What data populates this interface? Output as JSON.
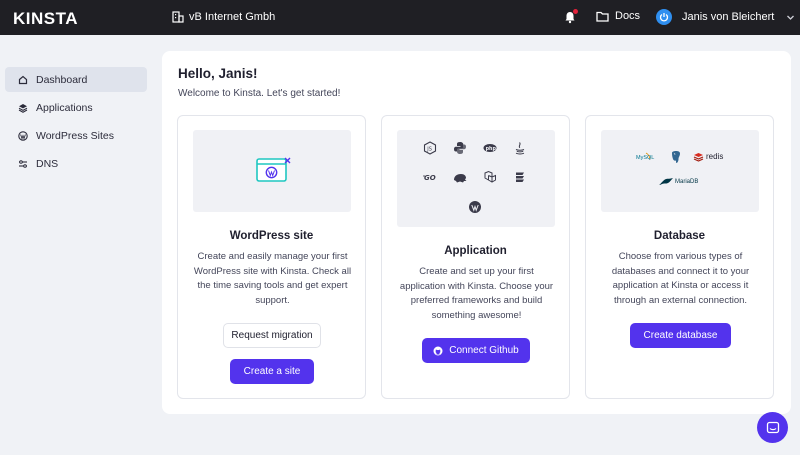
{
  "topbar": {
    "logo": "KINSTA",
    "company": "vB Internet Gmbh",
    "docs_label": "Docs",
    "user_name": "Janis von Bleichert"
  },
  "sidebar": {
    "items": [
      {
        "label": "Dashboard",
        "icon": "home-icon",
        "active": true
      },
      {
        "label": "Applications",
        "icon": "layers-icon",
        "active": false
      },
      {
        "label": "WordPress Sites",
        "icon": "wordpress-icon",
        "active": false
      },
      {
        "label": "DNS",
        "icon": "dns-icon",
        "active": false
      }
    ]
  },
  "main": {
    "greeting": "Hello, Janis!",
    "welcome": "Welcome to Kinsta. Let's get started!",
    "cards": [
      {
        "title": "WordPress site",
        "description_lines": [
          "Create and easily manage your first",
          "WordPress site with Kinsta. Check all",
          "the time saving tools and get expert",
          "support."
        ],
        "secondary_button": "Request migration",
        "primary_button": "Create a site"
      },
      {
        "title": "Application",
        "description_lines": [
          "Create and set up your first",
          "application with Kinsta. Choose your",
          "preferred frameworks and build",
          "something awesome!"
        ],
        "primary_button": "Connect Github"
      },
      {
        "title": "Database",
        "description_lines": [
          "Choose from various types of",
          "databases and connect it to your",
          "application at Kinsta or access it",
          "through an external connection."
        ],
        "primary_button": "Create database",
        "logos": [
          "MySQL",
          "redis",
          "MariaDB"
        ]
      }
    ]
  },
  "colors": {
    "topbar": "#1f1f24",
    "accent": "#5333ed",
    "background": "#f0f2f6"
  }
}
